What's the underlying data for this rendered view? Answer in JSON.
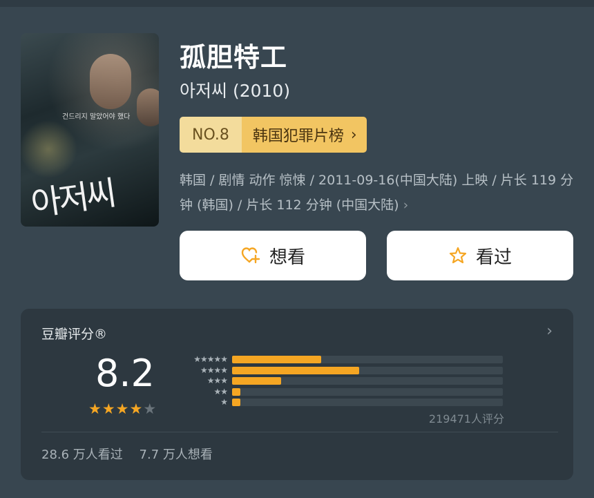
{
  "movie": {
    "title": "孤胆特工",
    "subtitle": "아저씨 (2010)",
    "poster_text": "아저씨",
    "poster_tagline": "건드리지 말았어야 했다"
  },
  "rank": {
    "number": "NO.8",
    "category": "韩国犯罪片榜",
    "chevron": "›"
  },
  "meta": {
    "info": "韩国 / 剧情 动作 惊悚 / 2011-09-16(中国大陆) 上映 / 片长 119 分钟 (韩国) / 片长 112 分钟 (中国大陆)",
    "chevron": "›"
  },
  "actions": {
    "want_label": "想看",
    "seen_label": "看过"
  },
  "rating": {
    "title": "豆瓣评分®",
    "chevron": "›",
    "score": "8.2",
    "stars_filled": 4,
    "stars_total": 5,
    "voters": "219471人评分",
    "distribution": [
      {
        "stars": "★★★★★",
        "fraction": 0.33
      },
      {
        "stars": "★★★★",
        "fraction": 0.47
      },
      {
        "stars": "★★★",
        "fraction": 0.18
      },
      {
        "stars": "★★",
        "fraction": 0.03
      },
      {
        "stars": "★",
        "fraction": 0.03
      }
    ],
    "watched": "28.6 万人看过",
    "wanted": "7.7 万人想看"
  },
  "colors": {
    "accent": "#f5a623",
    "background": "#384650",
    "card": "#2d3840",
    "rank_label": "#f3dc9c",
    "rank_category": "#f2c562"
  },
  "icons": {
    "want": "heart-plus-icon",
    "seen": "star-outline-icon"
  }
}
